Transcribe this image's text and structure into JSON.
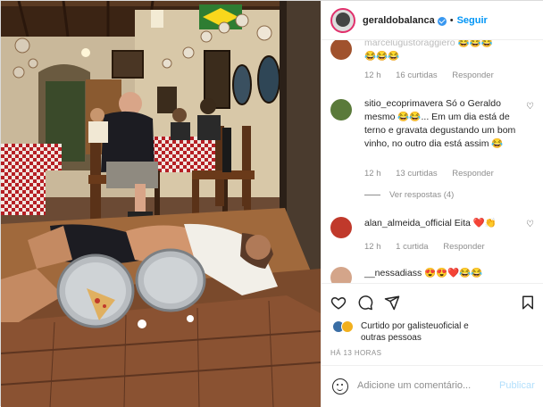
{
  "post": {
    "username": "geraldobalanca",
    "follow_label": "Seguir",
    "separator": "•"
  },
  "comments": [
    {
      "user": "marcelugustoraggiero",
      "text": "😂😂😂",
      "emoji_tail": "😂😂😂",
      "time": "12 h",
      "likes": "16 curtidas",
      "reply": "Responder",
      "avatar_color": "#a0522d"
    },
    {
      "user": "sitio_ecoprimavera",
      "text": "Só o Geraldo mesmo 😂😂... Em um dia está de terno e gravata degustando um bom vinho, no outro dia está assim 😂",
      "time": "12 h",
      "likes": "13 curtidas",
      "reply": "Responder",
      "view_replies": "Ver respostas (4)",
      "avatar_color": "#5a7a3a"
    },
    {
      "user": "alan_almeida_official",
      "text": "Eita ❤️👏",
      "time": "12 h",
      "likes": "1 curtida",
      "reply": "Responder",
      "avatar_color": "#c0392b"
    },
    {
      "user": "__nessadiass",
      "text": "😍😍❤️😂😂",
      "avatar_color": "#d4a58a"
    }
  ],
  "likes": {
    "prefix": "Curtido por",
    "user": "galisteuoficial",
    "suffix": "e",
    "others": "outras pessoas"
  },
  "timestamp": "HÁ 13 HORAS",
  "add_comment": {
    "placeholder": "Adicione um comentário...",
    "publish": "Publicar"
  },
  "colors": {
    "link_blue": "#0095f6",
    "muted": "#8e8e8e",
    "publish_disabled": "#b2dffc",
    "verified": "#3897f0"
  },
  "icons": [
    "verified-badge-icon",
    "heart-icon",
    "comment-icon",
    "share-icon",
    "bookmark-icon",
    "emoji-icon"
  ]
}
